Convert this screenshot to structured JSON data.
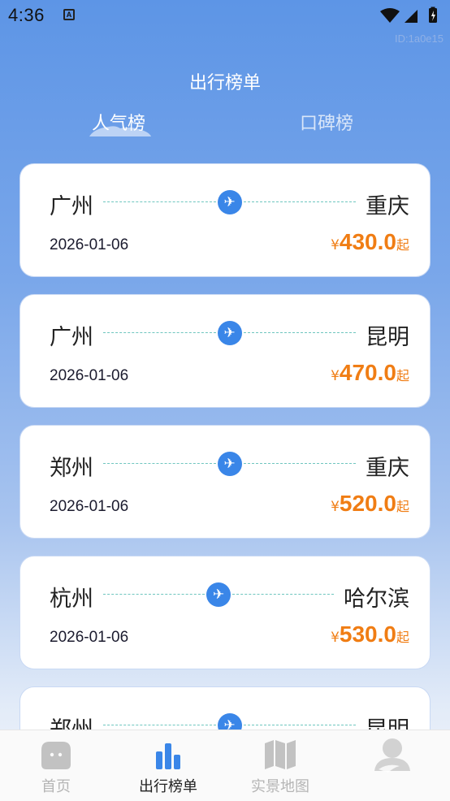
{
  "status_bar": {
    "time": "4:36",
    "notification_badge": "A"
  },
  "watermark": "ID:1a0e15",
  "header": {
    "title": "出行榜单",
    "tabs": [
      {
        "label": "人气榜",
        "active": true
      },
      {
        "label": "口碑榜",
        "active": false
      }
    ]
  },
  "routes": [
    {
      "from": "广州",
      "to": "重庆",
      "date": "2026-01-06",
      "currency": "¥",
      "price": "430.0",
      "suffix": "起"
    },
    {
      "from": "广州",
      "to": "昆明",
      "date": "2026-01-06",
      "currency": "¥",
      "price": "470.0",
      "suffix": "起"
    },
    {
      "from": "郑州",
      "to": "重庆",
      "date": "2026-01-06",
      "currency": "¥",
      "price": "520.0",
      "suffix": "起"
    },
    {
      "from": "杭州",
      "to": "哈尔滨",
      "date": "2026-01-06",
      "currency": "¥",
      "price": "530.0",
      "suffix": "起"
    },
    {
      "from": "郑州",
      "to": "昆明",
      "date": "",
      "currency": "",
      "price": "",
      "suffix": ""
    }
  ],
  "bottom_nav": [
    {
      "label": "首页",
      "icon": "home-icon",
      "active": false
    },
    {
      "label": "出行榜单",
      "icon": "bar-chart-icon",
      "active": true
    },
    {
      "label": "实景地图",
      "icon": "map-icon",
      "active": false
    },
    {
      "label": "",
      "icon": "profile-icon",
      "active": false
    }
  ],
  "colors": {
    "accent_blue": "#3a86e8",
    "price_orange": "#f07d14",
    "route_dash": "#6fc6bf"
  }
}
